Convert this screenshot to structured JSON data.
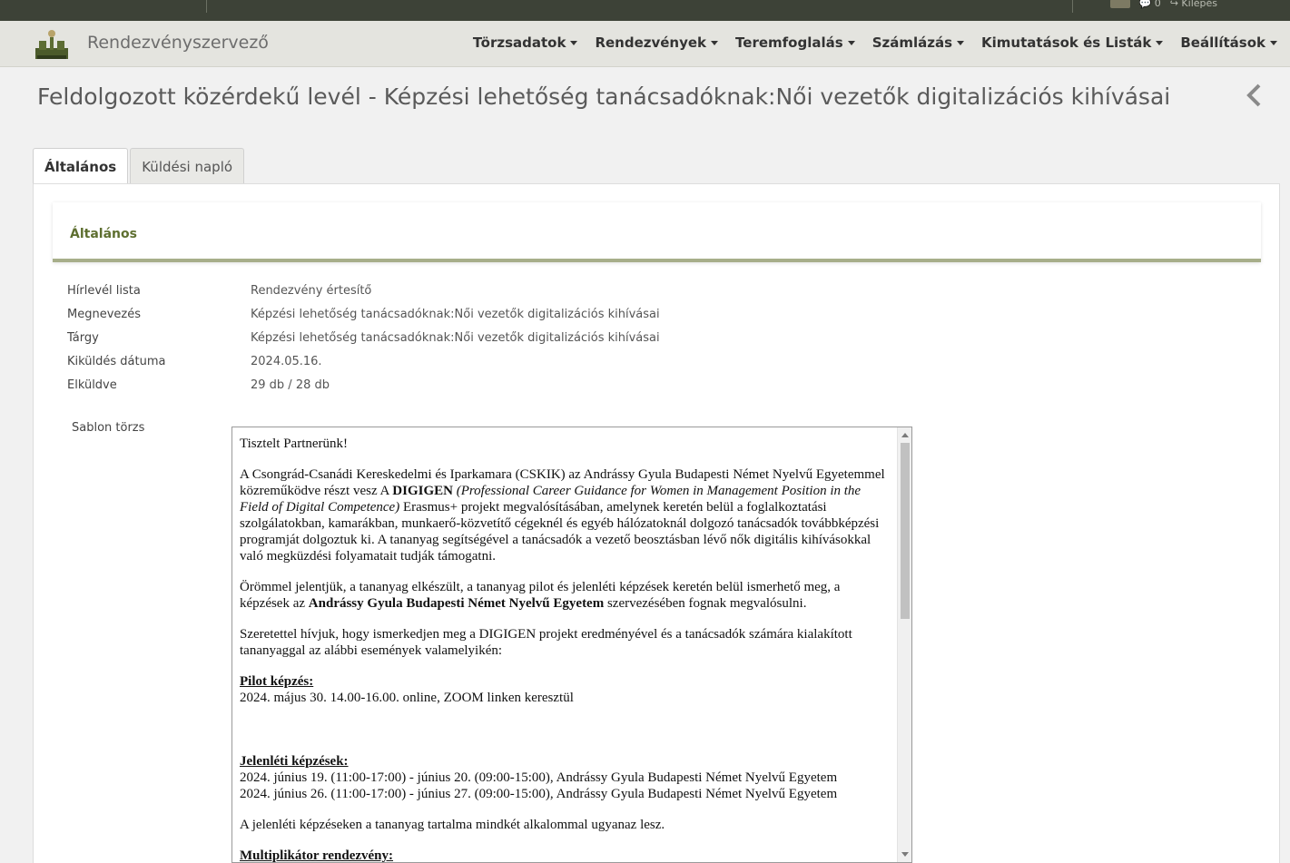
{
  "topbar": {
    "messages_count": "0",
    "logout_label": "Kilépés"
  },
  "navbar": {
    "brand": "Rendezvényszervező",
    "menu": [
      {
        "label": "Törzsadatok"
      },
      {
        "label": "Rendezvények"
      },
      {
        "label": "Teremfoglalás"
      },
      {
        "label": "Számlázás"
      },
      {
        "label": "Kimutatások és Listák"
      },
      {
        "label": "Beállítások"
      }
    ]
  },
  "page": {
    "title": "Feldolgozott közérdekű levél - Képzési lehetőség tanácsadóknak:Női vezetők digitalizációs kihívásai"
  },
  "tabs": [
    {
      "label": "Általános",
      "active": true
    },
    {
      "label": "Küldési napló",
      "active": false
    }
  ],
  "section": {
    "title": "Általános"
  },
  "fields": [
    {
      "label": "Hírlevél lista",
      "value": "Rendezvény értesítő"
    },
    {
      "label": "Megnevezés",
      "value": "Képzési lehetőség tanácsadóknak:Női vezetők digitalizációs kihívásai"
    },
    {
      "label": "Tárgy",
      "value": "Képzési lehetőség tanácsadóknak:Női vezetők digitalizációs kihívásai"
    },
    {
      "label": "Kiküldés dátuma",
      "value": "2024.05.16."
    },
    {
      "label": "Elküldve",
      "value": "29 db / 28 db"
    }
  ],
  "template": {
    "label": "Sablon törzs",
    "greeting": "Tisztelt Partnerünk!",
    "p1_a": "A Csongrád-Csanádi Kereskedelmi és Iparkamara (CSKIK) az Andrássy Gyula Budapesti Német Nyelvű Egyetemmel közreműködve részt vesz A ",
    "p1_bold": "DIGIGEN",
    "p1_italic": " (Professional Career Guidance for Women in Management Position in the Field of Digital Competence)",
    "p1_b": " Erasmus+ projekt megvalósításában, amelynek keretén belül a foglalkoztatási szolgálatokban, kamarákban, munkaerő-közvetítő cégeknél és egyéb hálózatoknál dolgozó tanácsadók továbbképzési programját dolgoztuk ki. A tananyag segítségével a tanácsadók a vezető beosztásban lévő nők digitális kihívásokkal való megküzdési folyamatait tudják támogatni.",
    "p2_a": "Örömmel jelentjük, a tananyag elkészült, a tananyag pilot és jelenléti képzések keretén belül ismerhető meg, a képzések az ",
    "p2_bold": "Andrássy Gyula Budapesti Német Nyelvű Egyetem",
    "p2_b": " szervezésében fognak megvalósulni.",
    "p3": "Szeretettel hívjuk, hogy ismerkedjen meg a DIGIGEN projekt eredményével és a tanácsadók számára kialakított tananyaggal az alábbi események valamelyikén:",
    "pilot_heading": "Pilot képzés:",
    "pilot_line": "2024. május 30. 14.00-16.00. online, ZOOM linken keresztül",
    "presence_heading": "Jelenléti képzések:",
    "presence_line1": "2024. június 19. (11:00-17:00) - június 20. (09:00-15:00), Andrássy Gyula Budapesti Német Nyelvű Egyetem",
    "presence_line2": "2024. június 26. (11:00-17:00) - június 27. (09:00-15:00), Andrássy Gyula Budapesti Német Nyelvű Egyetem",
    "p4": "A jelenléti képzéseken a tananyag tartalma mindkét alkalommal ugyanaz lesz.",
    "multiplier_heading": "Multiplikátor rendezvény:"
  }
}
